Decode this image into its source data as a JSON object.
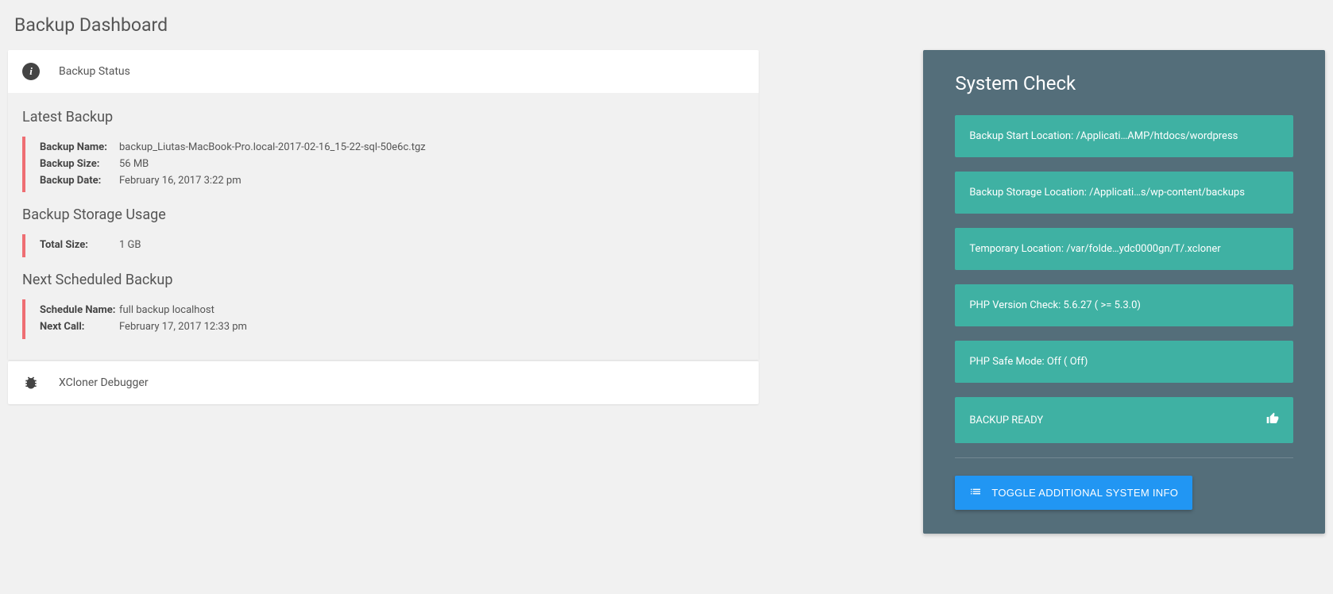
{
  "page": {
    "title": "Backup Dashboard"
  },
  "status_panel": {
    "title": "Backup Status",
    "latest_title": "Latest Backup",
    "latest": {
      "name_label": "Backup Name:",
      "name_value": "backup_Liutas-MacBook-Pro.local-2017-02-16_15-22-sql-50e6c.tgz",
      "size_label": "Backup Size:",
      "size_value": "56 MB",
      "date_label": "Backup Date:",
      "date_value": "February 16, 2017 3:22 pm"
    },
    "storage_title": "Backup Storage Usage",
    "storage": {
      "total_label": "Total Size:",
      "total_value": "1 GB"
    },
    "next_title": "Next Scheduled Backup",
    "next": {
      "schedule_label": "Schedule Name:",
      "schedule_value": "full backup localhost",
      "call_label": "Next Call:",
      "call_value": "February 17, 2017 12:33 pm"
    }
  },
  "debugger_panel": {
    "title": "XCloner Debugger"
  },
  "system": {
    "title": "System Check",
    "items": [
      "Backup Start Location: /Applicati…AMP/htdocs/wordpress",
      "Backup Storage Location: /Applicati…s/wp-content/backups",
      "Temporary Location: /var/folde…ydc0000gn/T/.xcloner",
      "PHP Version Check: 5.6.27 ( >= 5.3.0)",
      "PHP Safe Mode: Off ( Off)",
      "BACKUP READY"
    ],
    "toggle_label": "TOGGLE ADDITIONAL SYSTEM INFO"
  }
}
